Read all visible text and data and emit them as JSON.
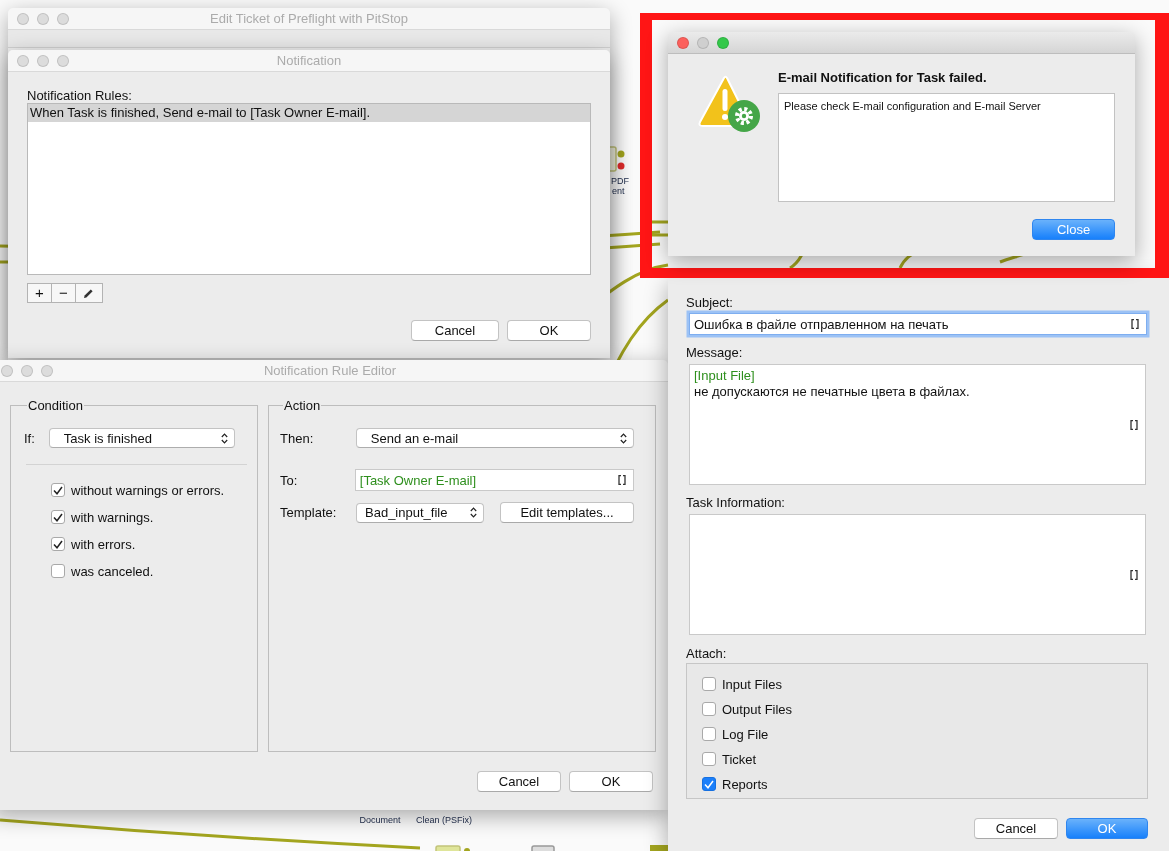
{
  "background": {
    "labels": [
      "PDF",
      "ent",
      "Document",
      "Clean (PSFix)"
    ]
  },
  "edit_ticket_window": {
    "title": "Edit Ticket of Preflight with PitStop",
    "active": false
  },
  "notification_window": {
    "title": "Notification",
    "active": false,
    "rules_label": "Notification Rules:",
    "rules": [
      {
        "text": "When Task is finished, Send e-mail to [Task Owner E-mail].",
        "selected": true
      }
    ],
    "add_button": "+",
    "remove_button": "−",
    "buttons": [
      {
        "label": "Cancel",
        "default": false
      },
      {
        "label": "OK",
        "default": false
      }
    ]
  },
  "rule_editor": {
    "title": "Notification Rule Editor",
    "active": false,
    "condition": {
      "legend": "Condition",
      "if_label": "If:",
      "if_value": "Task is finished",
      "options": [
        {
          "label": "without warnings or errors.",
          "checked": true
        },
        {
          "label": "with warnings.",
          "checked": true
        },
        {
          "label": "with errors.",
          "checked": true
        },
        {
          "label": "was canceled.",
          "checked": false
        }
      ]
    },
    "action": {
      "legend": "Action",
      "then_label": "Then:",
      "then_value": "Send an e-mail",
      "to_label": "To:",
      "to_value": "[Task Owner E-mail]",
      "template_label": "Template:",
      "template_value": "Bad_input_file",
      "edit_templates_button": "Edit templates..."
    },
    "buttons": [
      {
        "label": "Cancel",
        "default": false
      },
      {
        "label": "OK",
        "default": false
      }
    ]
  },
  "template_editor": {
    "subject_label": "Subject:",
    "subject_value": "Ошибка в файле отправленном на печать",
    "subject_focused": true,
    "message_label": "Message:",
    "message_lines": [
      {
        "text": "[Input File]",
        "kind": "variable"
      },
      {
        "text": "не допускаются не печатные цвета в файлах.",
        "kind": "plain"
      }
    ],
    "task_info_label": "Task Information:",
    "attach_label": "Attach:",
    "attach": [
      {
        "label": "Input Files",
        "checked": false
      },
      {
        "label": "Output Files",
        "checked": false
      },
      {
        "label": "Log File",
        "checked": false
      },
      {
        "label": "Ticket",
        "checked": false
      },
      {
        "label": "Reports",
        "checked": true
      }
    ],
    "buttons": [
      {
        "label": "Cancel",
        "default": false
      },
      {
        "label": "OK",
        "default": true
      }
    ]
  },
  "alert": {
    "active": true,
    "heading": "E-mail Notification for Task failed.",
    "message": "Please check E-mail configuration and E-mail Server",
    "close_button": {
      "label": "Close",
      "default": true
    }
  }
}
